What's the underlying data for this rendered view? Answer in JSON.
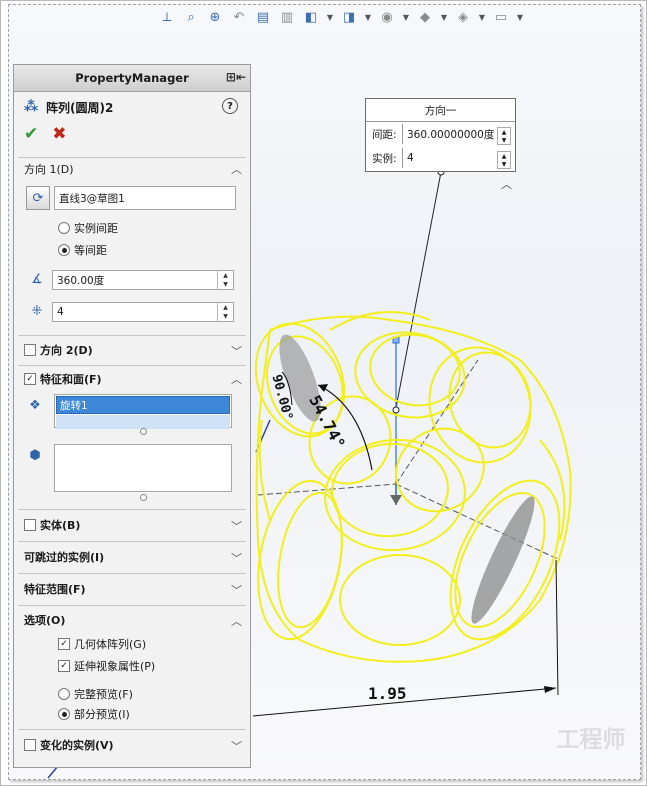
{
  "toolbar": {
    "icons": [
      "view-orientation-icon",
      "zoom-fit-icon",
      "zoom-area-icon",
      "previous-view-icon",
      "section-view-icon",
      "dynamic-annotation-icon",
      "view-cube-icon",
      "display-style-icon",
      "hide-show-icon",
      "edit-appearance-icon",
      "apply-scene-icon",
      "view-settings-icon"
    ]
  },
  "pm": {
    "title": "PropertyManager",
    "feature_title": "阵列(圆周)2",
    "help": "?",
    "ok": "✔",
    "cancel": "✖",
    "direction1": {
      "header": "方向 1(D)",
      "axis_value": "直线3@草图1",
      "radio_instance_spacing": "实例间距",
      "radio_equal_spacing": "等间距",
      "angle_value": "360.00度",
      "count_value": "4"
    },
    "direction2": {
      "header": "方向 2(D)"
    },
    "features": {
      "header": "特征和面(F)",
      "selected_item": "旋转1"
    },
    "bodies": {
      "header": "实体(B)"
    },
    "skip": {
      "header": "可跳过的实例(I)"
    },
    "scope": {
      "header": "特征范围(F)"
    },
    "options": {
      "header": "选项(O)",
      "geometry_pattern": "几何体阵列(G)",
      "propagate_visual": "延伸视象属性(P)",
      "full_preview": "完整预览(F)",
      "partial_preview": "部分预览(I)"
    },
    "varying": {
      "header": "变化的实例(V)"
    }
  },
  "callout": {
    "title": "方向一",
    "spacing_label": "间距:",
    "spacing_value": "360.00000000度",
    "count_label": "实例:",
    "count_value": "4"
  },
  "dimensions": {
    "angle1": "54.74°",
    "angle2": "90.00°",
    "length": "1.95"
  },
  "watermark": "工程师"
}
